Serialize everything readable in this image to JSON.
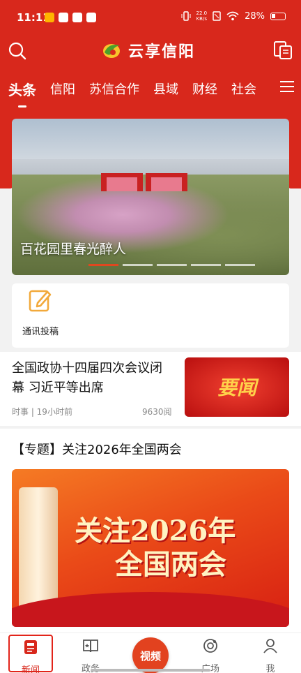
{
  "status_bar": {
    "time": "11:11",
    "net_speed_value": "22.0",
    "net_speed_unit": "KB/s",
    "battery": "28%"
  },
  "header": {
    "logo_text": "云享信阳",
    "read_icon": "reading-mode-icon",
    "search_icon": "search-icon"
  },
  "tabs": [
    {
      "label": "头条",
      "active": true
    },
    {
      "label": "信阳"
    },
    {
      "label": "苏信合作"
    },
    {
      "label": "县域"
    },
    {
      "label": "财经"
    },
    {
      "label": "社会"
    }
  ],
  "banner": {
    "caption": "百花园里春光醉人",
    "slide_count": 5,
    "active_slide": 1
  },
  "tools": [
    {
      "label": "通讯投稿",
      "icon": "edit-icon"
    }
  ],
  "news": {
    "title": "全国政协十四届四次会议闭幕 习近平等出席",
    "meta": "时事 | 19小时前",
    "views": "9630阅",
    "thumb_text": "要闻"
  },
  "topic": {
    "title": "【专题】关注2026年全国两会",
    "banner_line1": "关注2026年",
    "banner_line2": "全国两会"
  },
  "bottom_nav": {
    "news": "新闻",
    "gov": "政务",
    "video": "视频",
    "square": "广场",
    "me": "我"
  },
  "colors": {
    "brand_red": "#d8281c",
    "accent_orange": "#e2421f"
  }
}
